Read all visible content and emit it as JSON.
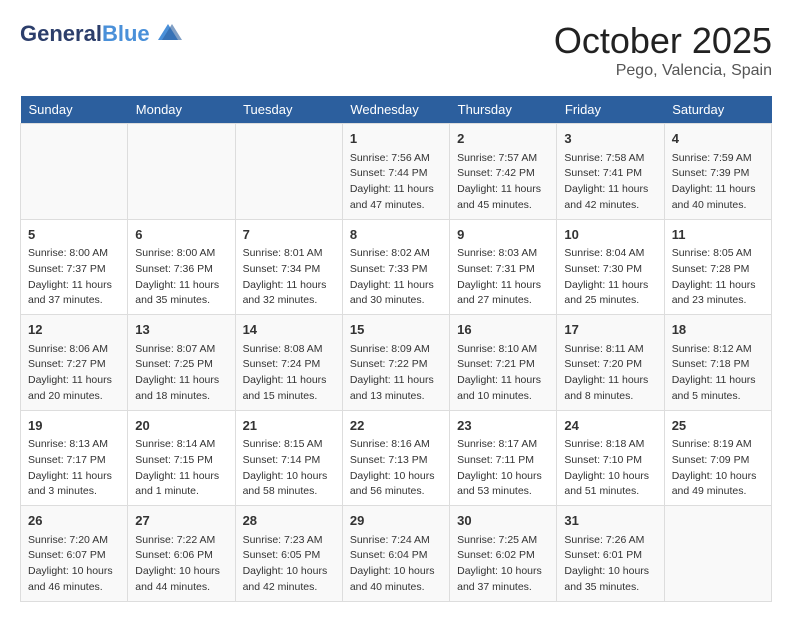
{
  "header": {
    "logo_line1": "General",
    "logo_line2": "Blue",
    "month": "October 2025",
    "location": "Pego, Valencia, Spain"
  },
  "weekdays": [
    "Sunday",
    "Monday",
    "Tuesday",
    "Wednesday",
    "Thursday",
    "Friday",
    "Saturday"
  ],
  "weeks": [
    [
      {
        "day": "",
        "info": ""
      },
      {
        "day": "",
        "info": ""
      },
      {
        "day": "",
        "info": ""
      },
      {
        "day": "1",
        "info": "Sunrise: 7:56 AM\nSunset: 7:44 PM\nDaylight: 11 hours\nand 47 minutes."
      },
      {
        "day": "2",
        "info": "Sunrise: 7:57 AM\nSunset: 7:42 PM\nDaylight: 11 hours\nand 45 minutes."
      },
      {
        "day": "3",
        "info": "Sunrise: 7:58 AM\nSunset: 7:41 PM\nDaylight: 11 hours\nand 42 minutes."
      },
      {
        "day": "4",
        "info": "Sunrise: 7:59 AM\nSunset: 7:39 PM\nDaylight: 11 hours\nand 40 minutes."
      }
    ],
    [
      {
        "day": "5",
        "info": "Sunrise: 8:00 AM\nSunset: 7:37 PM\nDaylight: 11 hours\nand 37 minutes."
      },
      {
        "day": "6",
        "info": "Sunrise: 8:00 AM\nSunset: 7:36 PM\nDaylight: 11 hours\nand 35 minutes."
      },
      {
        "day": "7",
        "info": "Sunrise: 8:01 AM\nSunset: 7:34 PM\nDaylight: 11 hours\nand 32 minutes."
      },
      {
        "day": "8",
        "info": "Sunrise: 8:02 AM\nSunset: 7:33 PM\nDaylight: 11 hours\nand 30 minutes."
      },
      {
        "day": "9",
        "info": "Sunrise: 8:03 AM\nSunset: 7:31 PM\nDaylight: 11 hours\nand 27 minutes."
      },
      {
        "day": "10",
        "info": "Sunrise: 8:04 AM\nSunset: 7:30 PM\nDaylight: 11 hours\nand 25 minutes."
      },
      {
        "day": "11",
        "info": "Sunrise: 8:05 AM\nSunset: 7:28 PM\nDaylight: 11 hours\nand 23 minutes."
      }
    ],
    [
      {
        "day": "12",
        "info": "Sunrise: 8:06 AM\nSunset: 7:27 PM\nDaylight: 11 hours\nand 20 minutes."
      },
      {
        "day": "13",
        "info": "Sunrise: 8:07 AM\nSunset: 7:25 PM\nDaylight: 11 hours\nand 18 minutes."
      },
      {
        "day": "14",
        "info": "Sunrise: 8:08 AM\nSunset: 7:24 PM\nDaylight: 11 hours\nand 15 minutes."
      },
      {
        "day": "15",
        "info": "Sunrise: 8:09 AM\nSunset: 7:22 PM\nDaylight: 11 hours\nand 13 minutes."
      },
      {
        "day": "16",
        "info": "Sunrise: 8:10 AM\nSunset: 7:21 PM\nDaylight: 11 hours\nand 10 minutes."
      },
      {
        "day": "17",
        "info": "Sunrise: 8:11 AM\nSunset: 7:20 PM\nDaylight: 11 hours\nand 8 minutes."
      },
      {
        "day": "18",
        "info": "Sunrise: 8:12 AM\nSunset: 7:18 PM\nDaylight: 11 hours\nand 5 minutes."
      }
    ],
    [
      {
        "day": "19",
        "info": "Sunrise: 8:13 AM\nSunset: 7:17 PM\nDaylight: 11 hours\nand 3 minutes."
      },
      {
        "day": "20",
        "info": "Sunrise: 8:14 AM\nSunset: 7:15 PM\nDaylight: 11 hours\nand 1 minute."
      },
      {
        "day": "21",
        "info": "Sunrise: 8:15 AM\nSunset: 7:14 PM\nDaylight: 10 hours\nand 58 minutes."
      },
      {
        "day": "22",
        "info": "Sunrise: 8:16 AM\nSunset: 7:13 PM\nDaylight: 10 hours\nand 56 minutes."
      },
      {
        "day": "23",
        "info": "Sunrise: 8:17 AM\nSunset: 7:11 PM\nDaylight: 10 hours\nand 53 minutes."
      },
      {
        "day": "24",
        "info": "Sunrise: 8:18 AM\nSunset: 7:10 PM\nDaylight: 10 hours\nand 51 minutes."
      },
      {
        "day": "25",
        "info": "Sunrise: 8:19 AM\nSunset: 7:09 PM\nDaylight: 10 hours\nand 49 minutes."
      }
    ],
    [
      {
        "day": "26",
        "info": "Sunrise: 7:20 AM\nSunset: 6:07 PM\nDaylight: 10 hours\nand 46 minutes."
      },
      {
        "day": "27",
        "info": "Sunrise: 7:22 AM\nSunset: 6:06 PM\nDaylight: 10 hours\nand 44 minutes."
      },
      {
        "day": "28",
        "info": "Sunrise: 7:23 AM\nSunset: 6:05 PM\nDaylight: 10 hours\nand 42 minutes."
      },
      {
        "day": "29",
        "info": "Sunrise: 7:24 AM\nSunset: 6:04 PM\nDaylight: 10 hours\nand 40 minutes."
      },
      {
        "day": "30",
        "info": "Sunrise: 7:25 AM\nSunset: 6:02 PM\nDaylight: 10 hours\nand 37 minutes."
      },
      {
        "day": "31",
        "info": "Sunrise: 7:26 AM\nSunset: 6:01 PM\nDaylight: 10 hours\nand 35 minutes."
      },
      {
        "day": "",
        "info": ""
      }
    ]
  ]
}
